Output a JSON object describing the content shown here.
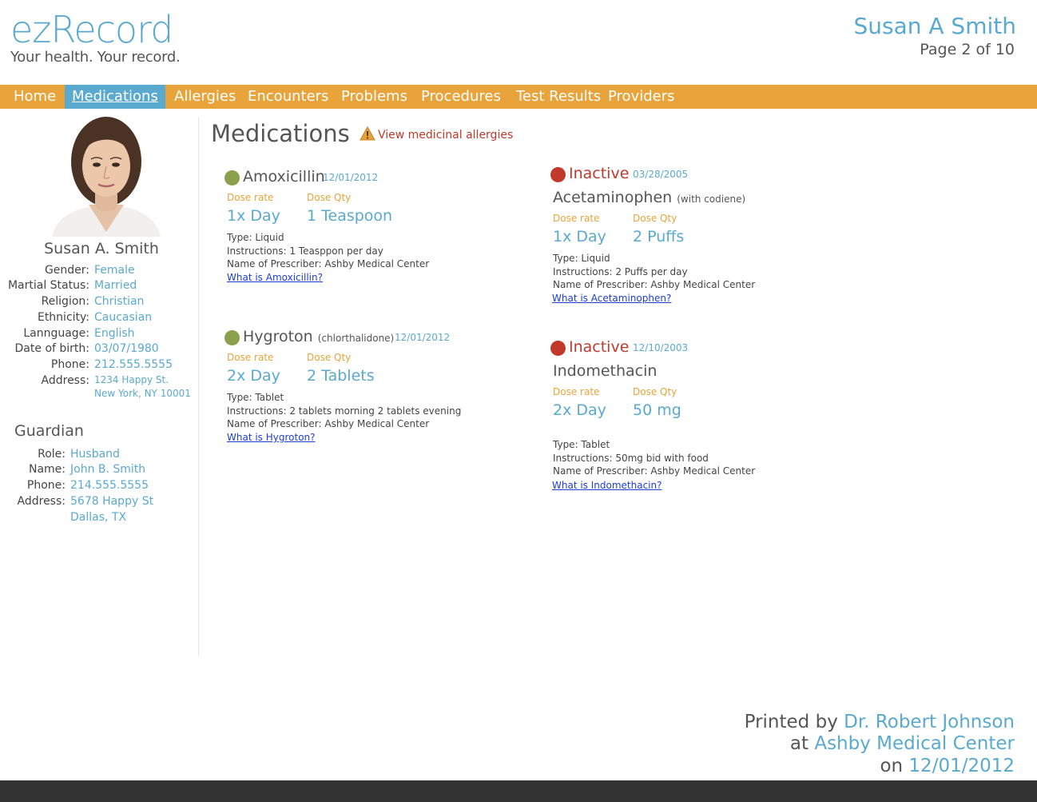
{
  "header": {
    "logo": "ezRecord",
    "tagline": "Your health. Your record.",
    "patient_name": "Susan A Smith",
    "page_indicator": "Page 2 of 10"
  },
  "nav": {
    "items": [
      "Home",
      "Medications",
      "Allergies",
      "Encounters",
      "Problems",
      "Procedures",
      "Test Results",
      "Providers"
    ],
    "active": "Medications"
  },
  "patient": {
    "name": "Susan A. Smith",
    "fields": [
      {
        "label": "Gender:",
        "value": "Female"
      },
      {
        "label": "Martial Status:",
        "value": "Married"
      },
      {
        "label": "Religion:",
        "value": "Christian"
      },
      {
        "label": "Ethnicity:",
        "value": "Caucasian"
      },
      {
        "label": "Lannguage:",
        "value": "English"
      },
      {
        "label": "Date of birth:",
        "value": "03/07/1980"
      },
      {
        "label": "Phone:",
        "value": "212.555.5555"
      }
    ],
    "address_label": "Address:",
    "address_line1": "1234 Happy St.",
    "address_line2": "New York, NY 10001"
  },
  "guardian": {
    "title": "Guardian",
    "fields": [
      {
        "label": "Role:",
        "value": "Husband"
      },
      {
        "label": "Name:",
        "value": "John B. Smith"
      },
      {
        "label": "Phone:",
        "value": "214.555.5555"
      }
    ],
    "address_label": "Address:",
    "address_line1": "5678 Happy St",
    "address_line2": "Dallas, TX"
  },
  "main": {
    "title": "Medications",
    "allergy_link": "View medicinal allergies",
    "dose_rate_label": "Dose rate",
    "dose_qty_label": "Dose Qty",
    "active_meds": [
      {
        "name": "Amoxicillin",
        "generic": "",
        "date": "12/01/2012",
        "dose_rate": "1x Day",
        "dose_qty": "1 Teaspoon",
        "type": "Type: Liquid",
        "instructions": "Instructions: 1 Teasppon per day",
        "prescriber": "Name of Prescriber: Ashby Medical Center",
        "link": "What is Amoxicillin?"
      },
      {
        "name": "Hygroton",
        "generic": "(chlorthalidone)",
        "date": "12/01/2012",
        "dose_rate": "2x Day",
        "dose_qty": "2 Tablets",
        "type": "Type: Tablet",
        "instructions": "Instructions: 2 tablets morning 2 tablets evening",
        "prescriber": "Name of Prescriber: Ashby Medical Center",
        "link": "What is Hygroton?"
      }
    ],
    "inactive_meds": [
      {
        "status": "Inactive",
        "date": "03/28/2005",
        "name": "Acetaminophen",
        "generic": "(with codiene)",
        "dose_rate": "1x Day",
        "dose_qty": "2 Puffs",
        "type": "Type: Liquid",
        "instructions": "Instructions: 2 Puffs per day",
        "prescriber": "Name of Prescriber: Ashby Medical Center",
        "link": "What is Acetaminophen?"
      },
      {
        "status": "Inactive",
        "date": "12/10/2003",
        "name": "Indomethacin",
        "generic": "",
        "dose_rate": "2x Day",
        "dose_qty": "50 mg",
        "type": "Type: Tablet",
        "instructions": "Instructions: 50mg bid with food",
        "prescriber": "Name of Prescriber: Ashby Medical Center",
        "link": "What is Indomethacin?"
      }
    ]
  },
  "footer": {
    "printed_by_label": "Printed by",
    "printed_by": "Dr. Robert Johnson",
    "at_label": "at",
    "location": "Ashby Medical Center",
    "on_label": "on",
    "date": "12/01/2012"
  },
  "colors": {
    "accent_blue": "#5aa9cf",
    "accent_orange": "#e8a43a",
    "inactive_red": "#c0392b",
    "active_green": "#8aa04a",
    "footer_bar": "#333333"
  }
}
